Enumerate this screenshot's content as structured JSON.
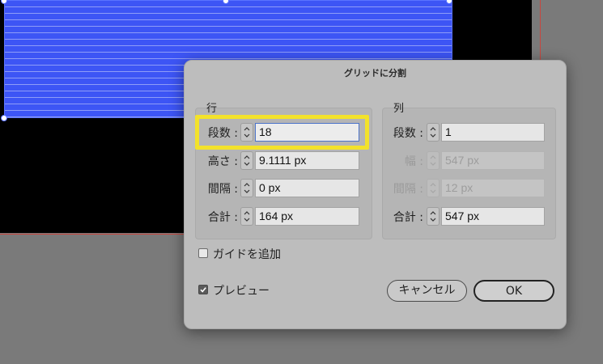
{
  "dialog": {
    "title": "グリッドに分割"
  },
  "rows_group": {
    "label": "行",
    "fields": {
      "count": {
        "label": "段数 :",
        "value": "18"
      },
      "height": {
        "label": "高さ :",
        "value": "9.1111 px"
      },
      "gutter": {
        "label": "間隔 :",
        "value": "0 px"
      },
      "total": {
        "label": "合計 :",
        "value": "164 px"
      }
    }
  },
  "columns_group": {
    "label": "列",
    "fields": {
      "count": {
        "label": "段数 :",
        "value": "1"
      },
      "width": {
        "label": "幅 :",
        "value": "547 px"
      },
      "gutter": {
        "label": "間隔 :",
        "value": "12 px"
      },
      "total": {
        "label": "合計 :",
        "value": "547 px"
      }
    }
  },
  "options": {
    "add_guides": {
      "label": "ガイドを追加",
      "checked": false
    },
    "preview": {
      "label": "プレビュー",
      "checked": true
    }
  },
  "buttons": {
    "cancel": "キャンセル",
    "ok": "OK"
  },
  "colors": {
    "highlight": "#f3e22b",
    "selection_fill": "#3d55f5",
    "artboard_border": "#c8473f",
    "active_field_border": "#4b73c9"
  }
}
